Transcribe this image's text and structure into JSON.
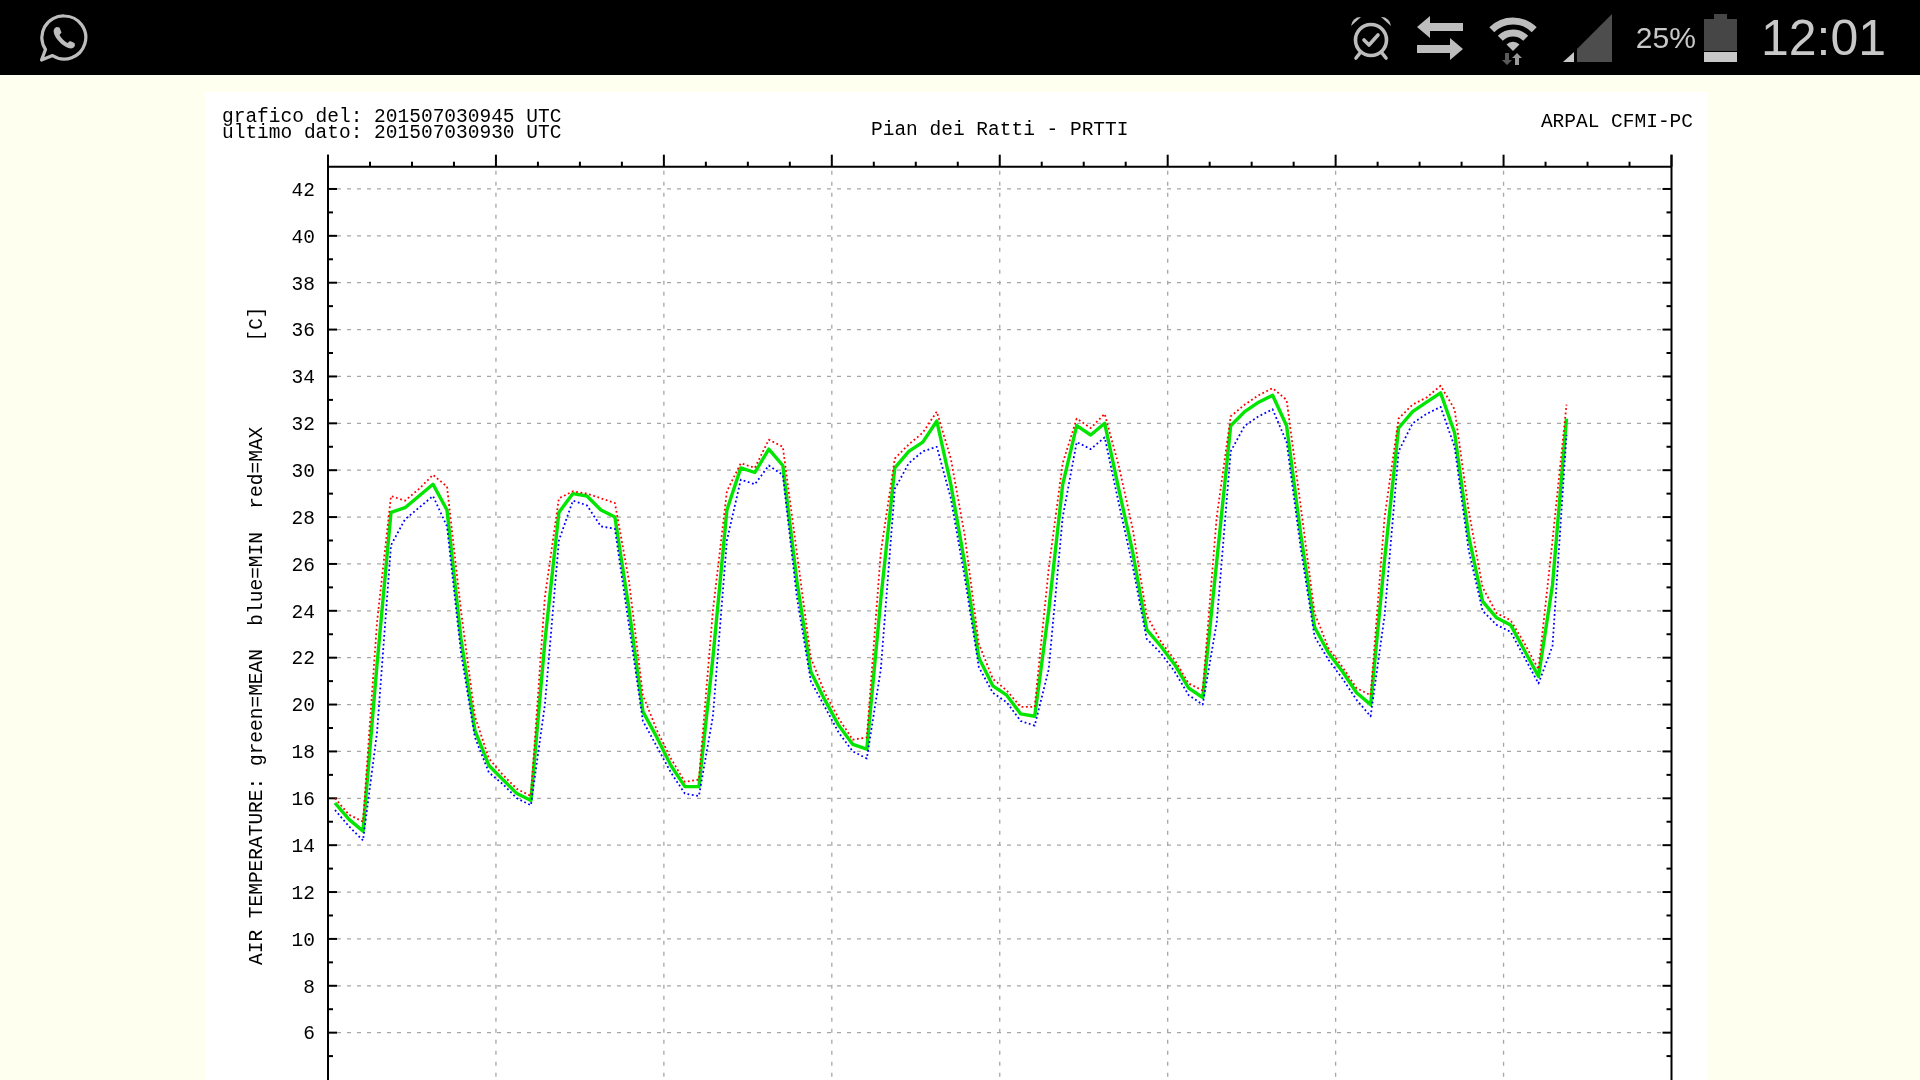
{
  "status_bar": {
    "battery_text": "25%",
    "time": "12:01"
  },
  "chart": {
    "header_lines": [
      "grafico del: 201507030945 UTC",
      "ultimo dato: 201507030930 UTC"
    ],
    "credit": "ARPAL CFMI-PC",
    "y_unit": "[C]",
    "chart_data": {
      "type": "line",
      "title": "Pian dei Ratti - PRTTI",
      "ylabel": "AIR TEMPERATURE: green=MEAN  blue=MIN  red=MAX",
      "grid": true,
      "ylim": [
        3.98,
        42.95
      ],
      "yticks": [
        6,
        8,
        10,
        12,
        14,
        16,
        18,
        20,
        22,
        24,
        26,
        28,
        30,
        32,
        34,
        36,
        38,
        40,
        42
      ],
      "categories": [
        null,
        null,
        null,
        null,
        null,
        null,
        null,
        null,
        null,
        null,
        null,
        null,
        null,
        null,
        null,
        null,
        null,
        null,
        null,
        null,
        null,
        null,
        null,
        null,
        null,
        null,
        null,
        null,
        null,
        null,
        null,
        null,
        null,
        null,
        null,
        null,
        null,
        null,
        null,
        null,
        null,
        null,
        null,
        null,
        null,
        null,
        null,
        null,
        null,
        null,
        null,
        null,
        null,
        null,
        null,
        null,
        null,
        null,
        null,
        null,
        null,
        null,
        null,
        null,
        null,
        null,
        null,
        null,
        null,
        null,
        null,
        null,
        null,
        null,
        null,
        null,
        null,
        null,
        null,
        null,
        null,
        null,
        null,
        null,
        null,
        null,
        null,
        null,
        null,
        null,
        null,
        null,
        null,
        null,
        null,
        null
      ],
      "series": [
        {
          "color": "#00e600",
          "line_style": "solid",
          "values": [
            15.8,
            15.1,
            14.6,
            21.7,
            28.2,
            28.4,
            28.9,
            29.4,
            28.3,
            22.8,
            18.9,
            17.4,
            16.8,
            16.2,
            15.9,
            22.7,
            28.2,
            29.0,
            28.9,
            28.3,
            28.0,
            24.1,
            19.7,
            18.6,
            17.4,
            16.5,
            16.5,
            22.0,
            28.3,
            30.1,
            29.9,
            30.9,
            30.2,
            25.3,
            21.4,
            20.2,
            19.1,
            18.3,
            18.1,
            24.5,
            30.1,
            30.8,
            31.2,
            32.1,
            29.4,
            26.0,
            22.0,
            20.8,
            20.4,
            19.6,
            19.5,
            24.0,
            29.4,
            31.9,
            31.5,
            32.0,
            29.2,
            26.5,
            23.2,
            22.5,
            21.7,
            20.7,
            20.3,
            26.1,
            31.9,
            32.5,
            32.9,
            33.2,
            31.9,
            27.3,
            23.3,
            22.2,
            21.4,
            20.5,
            20.0,
            26.2,
            31.8,
            32.5,
            32.9,
            33.3,
            31.6,
            27.2,
            24.4,
            23.7,
            23.4,
            22.3,
            21.2,
            25.1,
            32.2,
            null,
            null,
            null,
            null,
            null,
            null,
            null
          ]
        },
        {
          "color": "#0000ff",
          "line_style": "dotted",
          "values": [
            15.5,
            14.8,
            14.2,
            18.8,
            26.8,
            27.9,
            28.4,
            28.9,
            27.6,
            22.2,
            18.6,
            17.1,
            16.6,
            16.0,
            15.7,
            20.0,
            27.0,
            28.7,
            28.5,
            27.6,
            27.5,
            23.4,
            19.3,
            18.2,
            17.1,
            16.2,
            16.1,
            19.5,
            27.0,
            29.6,
            29.4,
            30.2,
            29.8,
            24.6,
            21.0,
            19.9,
            18.8,
            18.0,
            17.7,
            21.5,
            29.2,
            30.3,
            30.8,
            31.0,
            28.8,
            25.4,
            21.6,
            20.5,
            20.1,
            19.3,
            19.1,
            21.5,
            28.0,
            31.2,
            30.9,
            31.4,
            28.6,
            25.9,
            22.8,
            22.2,
            21.4,
            20.4,
            20.0,
            23.5,
            30.8,
            31.9,
            32.3,
            32.6,
            31.2,
            26.7,
            22.9,
            21.9,
            21.1,
            20.2,
            19.5,
            23.8,
            30.8,
            32.0,
            32.4,
            32.7,
            31.0,
            26.6,
            24.0,
            23.4,
            23.1,
            22.0,
            20.9,
            22.5,
            31.5,
            null,
            null,
            null,
            null,
            null,
            null,
            null
          ]
        },
        {
          "color": "#ff0000",
          "line_style": "dotted",
          "values": [
            16.0,
            15.3,
            15.0,
            23.5,
            28.9,
            28.7,
            29.2,
            29.8,
            29.3,
            24.0,
            19.5,
            17.7,
            17.0,
            16.4,
            16.1,
            24.6,
            28.8,
            29.1,
            29.0,
            28.8,
            28.6,
            25.3,
            20.4,
            18.9,
            17.7,
            16.7,
            16.8,
            24.0,
            29.1,
            30.3,
            30.1,
            31.3,
            31.0,
            26.5,
            22.0,
            20.5,
            19.4,
            18.5,
            18.6,
            26.5,
            30.5,
            31.1,
            31.6,
            32.5,
            30.5,
            27.2,
            22.6,
            21.1,
            20.6,
            19.9,
            19.9,
            25.8,
            30.3,
            32.2,
            31.8,
            32.4,
            30.2,
            27.5,
            23.8,
            22.7,
            21.9,
            20.9,
            20.6,
            28.0,
            32.3,
            32.8,
            33.2,
            33.5,
            33.0,
            28.5,
            23.9,
            22.4,
            21.6,
            20.7,
            20.4,
            28.0,
            32.2,
            32.8,
            33.1,
            33.6,
            32.6,
            28.3,
            25.0,
            23.9,
            23.6,
            22.6,
            21.5,
            27.0,
            32.8,
            null,
            null,
            null,
            null,
            null,
            null,
            null
          ]
        }
      ]
    }
  }
}
